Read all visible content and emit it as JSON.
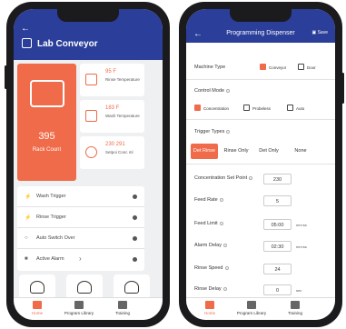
{
  "left_screen": {
    "title": "Lab Conveyor",
    "rack": {
      "value": "395",
      "label": "Rack Count"
    },
    "stats": [
      {
        "value": "95 F",
        "label": "Rinse Temperature",
        "icon": "rinse-icon"
      },
      {
        "value": "183 F",
        "label": "Wash Temperature",
        "icon": "wash-icon"
      },
      {
        "value": "230  291",
        "label": "Setpoi Conc ml",
        "icon": "setpoint-icon"
      }
    ],
    "rows": [
      {
        "label": "Wash Trigger",
        "icon": "bolt-icon",
        "glyph": "⚡"
      },
      {
        "label": "Rinse Trigger",
        "icon": "bolt-icon",
        "glyph": "⚡"
      },
      {
        "label": "Auto Switch Over",
        "icon": "circle-icon",
        "glyph": "○"
      },
      {
        "label": "Active Alarm",
        "icon": "alarm-icon",
        "glyph": "■",
        "chevron": "›"
      }
    ]
  },
  "right_screen": {
    "title": "Programming Dispenser",
    "save_label": "Save",
    "machine_type": {
      "label": "Machine Type",
      "options": [
        {
          "label": "Conveyor",
          "checked": true
        },
        {
          "label": "Door",
          "checked": false
        }
      ]
    },
    "control_mode": {
      "label": "Control Mode",
      "options": [
        {
          "label": "Concentration",
          "checked": true
        },
        {
          "label": "Probeless",
          "checked": false
        },
        {
          "label": "Auto",
          "checked": false
        }
      ]
    },
    "trigger_types": {
      "label": "Trigger Types",
      "options": [
        {
          "label": "Det Rinse",
          "active": true
        },
        {
          "label": "Rinse Only",
          "active": false
        },
        {
          "label": "Det Only",
          "active": false
        },
        {
          "label": "None",
          "active": false
        }
      ]
    },
    "fields": [
      {
        "label": "Concentration Set Point",
        "value": "230",
        "unit": ""
      },
      {
        "label": "Feed Rate",
        "value": "5",
        "unit": ""
      },
      {
        "label": "Feed Limit",
        "value": "05:00",
        "unit": "mm:ss"
      },
      {
        "label": "Alarm Delay",
        "value": "02:30",
        "unit": "mm:ss"
      },
      {
        "label": "Rinse Speed",
        "value": "24",
        "unit": ""
      },
      {
        "label": "Rinse Delay",
        "value": "0",
        "unit": "sec"
      }
    ]
  },
  "nav": {
    "items": [
      {
        "label": "Home",
        "active": true
      },
      {
        "label": "Program Library",
        "active": false
      },
      {
        "label": "Training",
        "active": false
      }
    ]
  },
  "colors": {
    "primary": "#2a3e9a",
    "accent": "#ef6b4a"
  }
}
